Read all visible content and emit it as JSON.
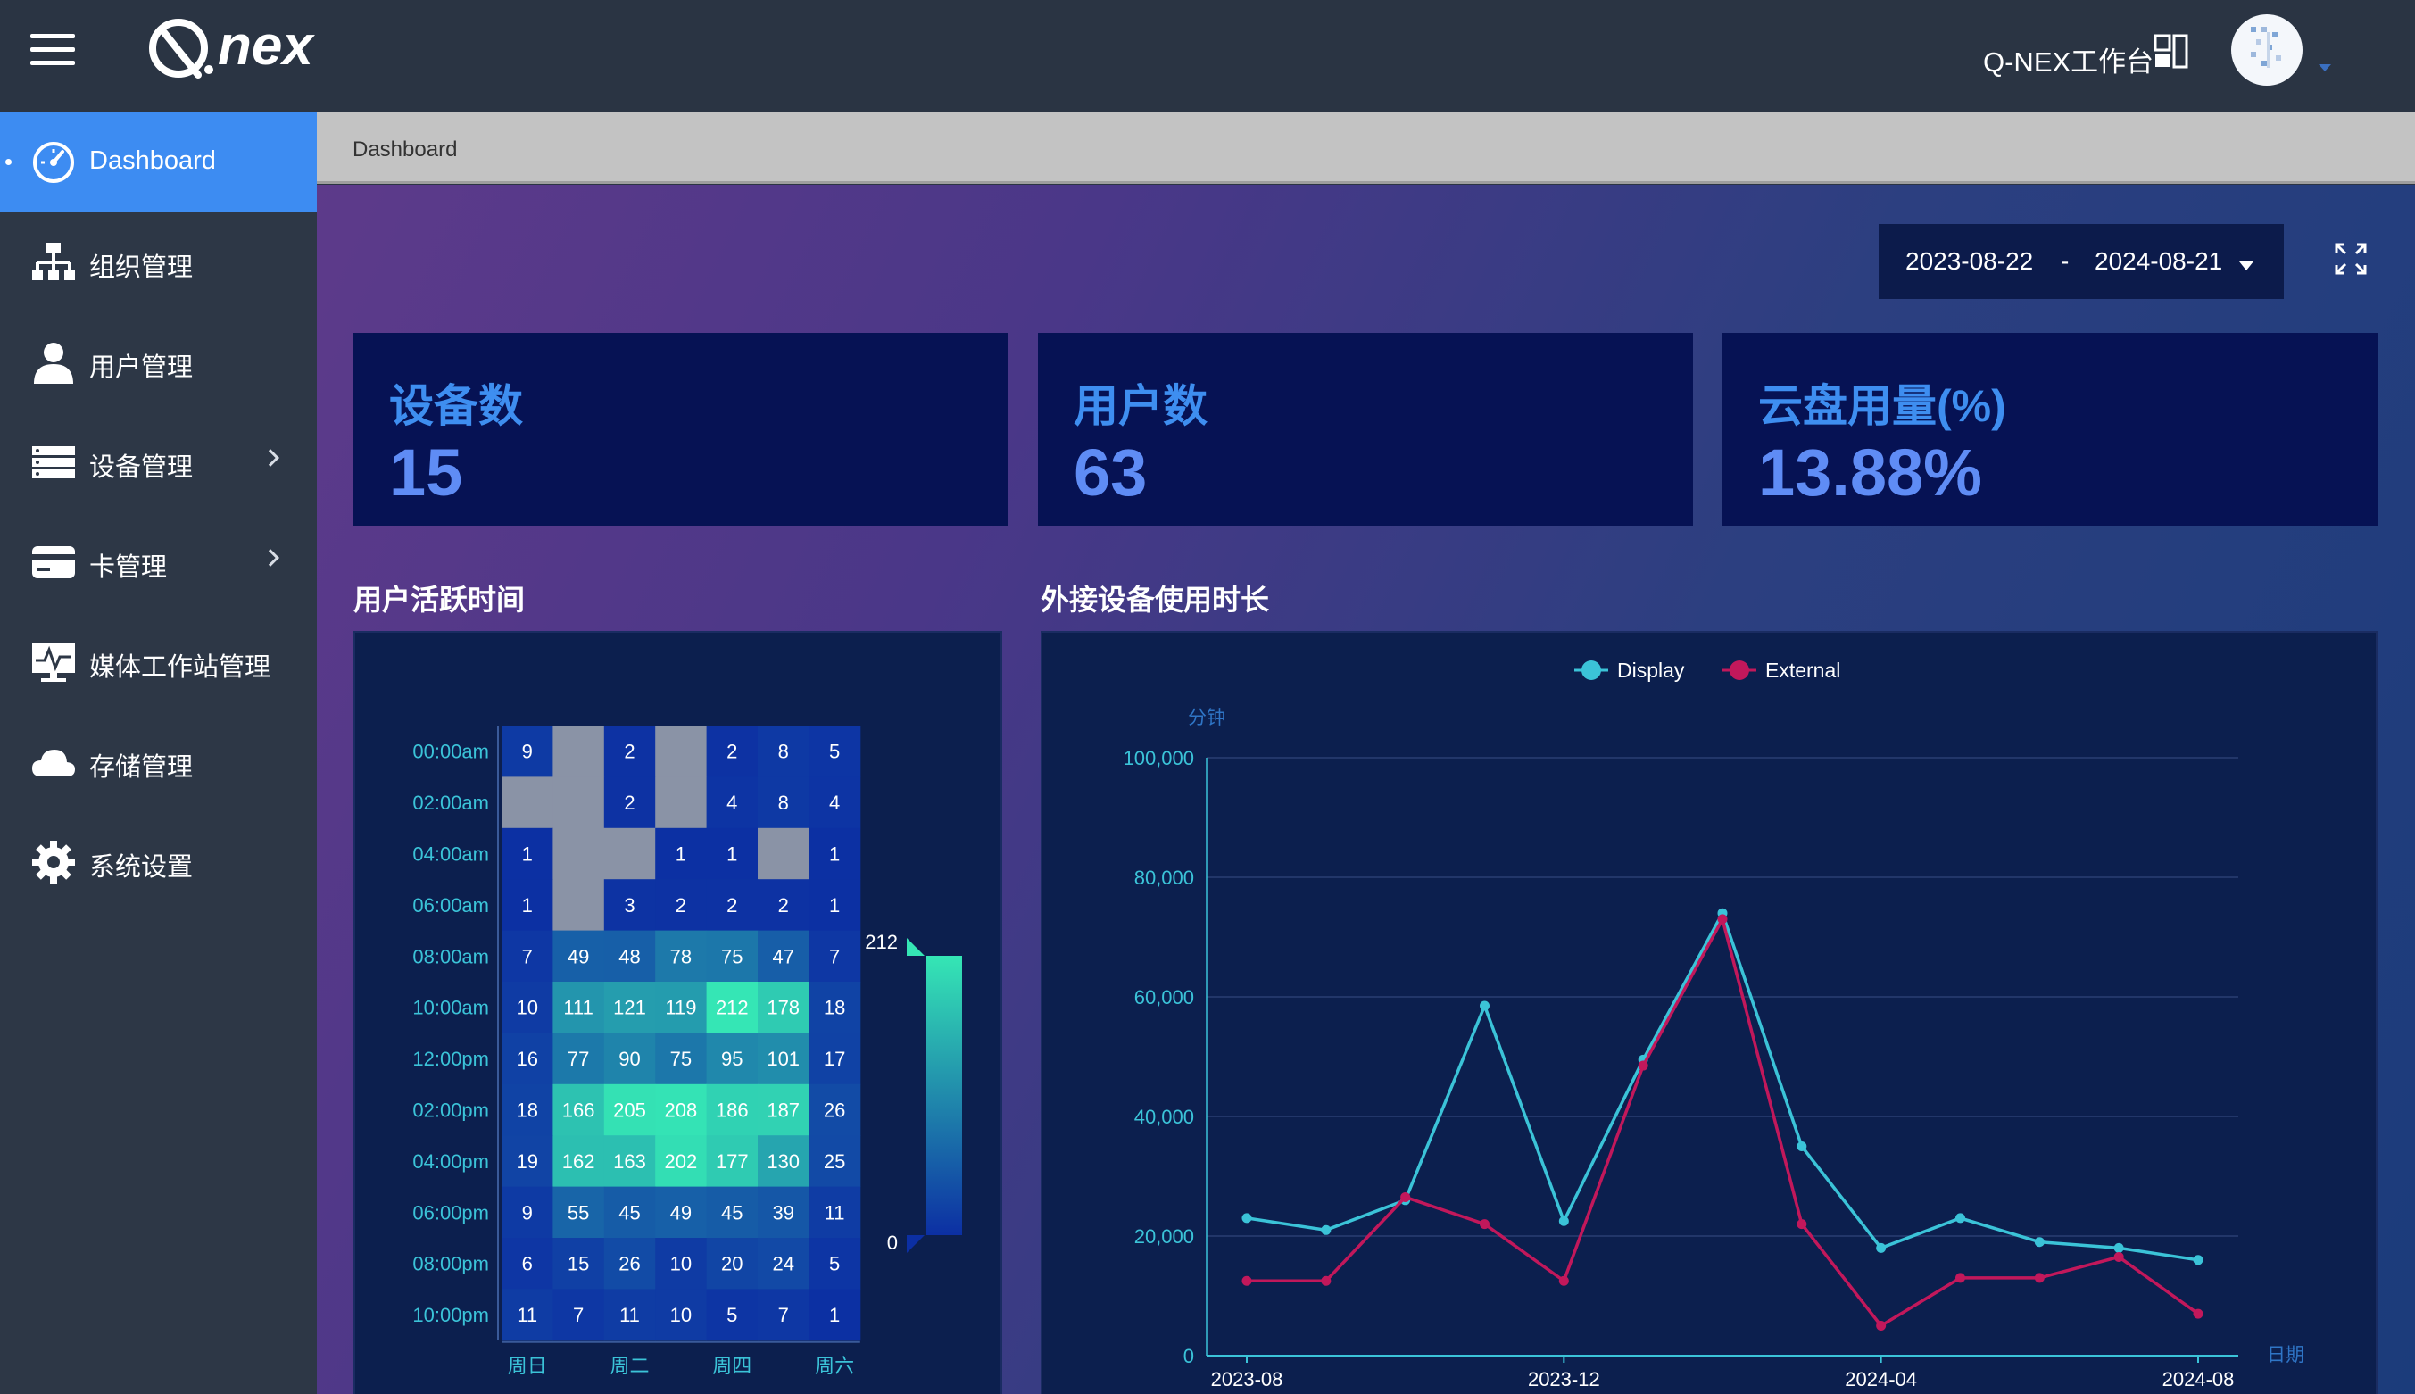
{
  "header": {
    "workspace_label": "Q-NEX工作台"
  },
  "sidebar": {
    "items": [
      {
        "label": "Dashboard",
        "icon": "dashboard-icon",
        "active": true,
        "has_submenu": false
      },
      {
        "label": "组织管理",
        "icon": "org-chart-icon",
        "active": false,
        "has_submenu": false
      },
      {
        "label": "用户管理",
        "icon": "user-icon",
        "active": false,
        "has_submenu": false
      },
      {
        "label": "设备管理",
        "icon": "server-icon",
        "active": false,
        "has_submenu": true
      },
      {
        "label": "卡管理",
        "icon": "card-icon",
        "active": false,
        "has_submenu": true
      },
      {
        "label": "媒体工作站管理",
        "icon": "media-station-icon",
        "active": false,
        "has_submenu": false
      },
      {
        "label": "存储管理",
        "icon": "cloud-icon",
        "active": false,
        "has_submenu": false
      },
      {
        "label": "系统设置",
        "icon": "gear-icon",
        "active": false,
        "has_submenu": false
      }
    ]
  },
  "breadcrumb": "Dashboard",
  "date_range": {
    "start": "2023-08-22",
    "separator": "-",
    "end": "2024-08-21"
  },
  "stats": [
    {
      "title": "设备数",
      "value": "15"
    },
    {
      "title": "用户数",
      "value": "63"
    },
    {
      "title": "云盘用量(%)",
      "value": "13.88%"
    }
  ],
  "sections": {
    "heatmap_title": "用户活跃时间",
    "line_title": "外接设备使用时长"
  },
  "colors": {
    "accent": "#3d8cf2",
    "display_series": "#3bc3d8",
    "external_series": "#c2185b",
    "heat_low": "#0c2fa3",
    "heat_high": "#35e6b5",
    "heat_null": "#8a93a6"
  },
  "chart_data": [
    {
      "type": "heatmap",
      "y_categories": [
        "00:00am",
        "02:00am",
        "04:00am",
        "06:00am",
        "08:00am",
        "10:00am",
        "12:00pm",
        "02:00pm",
        "04:00pm",
        "06:00pm",
        "08:00pm",
        "10:00pm"
      ],
      "x_labels_shown": [
        "周日",
        "周二",
        "周四",
        "周六"
      ],
      "values": [
        [
          9,
          null,
          2,
          null,
          2,
          8,
          5
        ],
        [
          null,
          null,
          2,
          null,
          4,
          8,
          4
        ],
        [
          1,
          null,
          null,
          1,
          1,
          null,
          1
        ],
        [
          1,
          null,
          3,
          2,
          2,
          2,
          1
        ],
        [
          7,
          49,
          48,
          78,
          75,
          47,
          7
        ],
        [
          10,
          111,
          121,
          119,
          212,
          178,
          18
        ],
        [
          16,
          77,
          90,
          75,
          95,
          101,
          17
        ],
        [
          18,
          166,
          205,
          208,
          186,
          187,
          26
        ],
        [
          19,
          162,
          163,
          202,
          177,
          130,
          25
        ],
        [
          9,
          55,
          45,
          49,
          45,
          39,
          11
        ],
        [
          6,
          15,
          26,
          10,
          20,
          24,
          5
        ],
        [
          11,
          7,
          11,
          10,
          5,
          7,
          1
        ]
      ],
      "visual_map": {
        "min": 0,
        "max": 212,
        "min_label": "0",
        "max_label": "212"
      }
    },
    {
      "type": "line",
      "legend": [
        "Display",
        "External"
      ],
      "ylabel": "分钟",
      "xlabel": "日期",
      "ylim": [
        0,
        100000
      ],
      "y_ticks": [
        "0",
        "20,000",
        "40,000",
        "60,000",
        "80,000",
        "100,000"
      ],
      "x_tick_labels": [
        "2023-08",
        "2023-12",
        "2024-04",
        "2024-08"
      ],
      "x": [
        "2023-08",
        "2023-09",
        "2023-10",
        "2023-11",
        "2023-12",
        "2024-01",
        "2024-02",
        "2024-03",
        "2024-04",
        "2024-05",
        "2024-06",
        "2024-07",
        "2024-08"
      ],
      "series": [
        {
          "name": "Display",
          "values": [
            23000,
            21000,
            26000,
            58500,
            22500,
            49500,
            74000,
            35000,
            18000,
            23000,
            19000,
            18000,
            16000
          ]
        },
        {
          "name": "External",
          "values": [
            12500,
            12500,
            26500,
            22000,
            12500,
            48500,
            73000,
            22000,
            5000,
            13000,
            13000,
            16500,
            7000
          ]
        }
      ]
    }
  ]
}
